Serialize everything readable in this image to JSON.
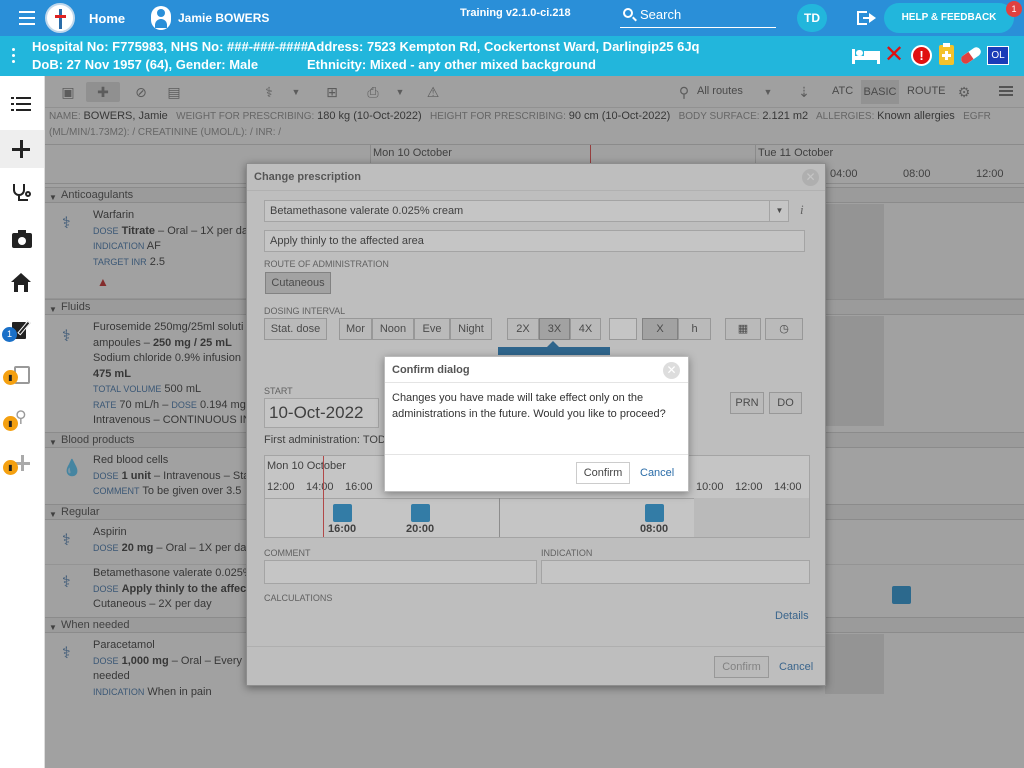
{
  "topbar": {
    "home_label": "Home",
    "patient_name": "Jamie BOWERS",
    "version": "Training v2.1.0-ci.218",
    "search_label": "Search",
    "user_initials": "TD",
    "help_label": "HELP & FEEDBACK",
    "help_badge": "1"
  },
  "patient_bar": {
    "line1_left": "Hospital No: F775983, NHS No: ###-###-####",
    "line1_right": "Address: 7523 Kempton Rd, Cockertonst Ward, Darlingip25 6Jq",
    "line2_left": "DoB: 27 Nov 1957 (64), Gender: Male",
    "line2_right": "Ethnicity: Mixed - any other mixed background",
    "ol_badge": "OL"
  },
  "leftnav": {
    "badge": "1"
  },
  "toolbar": {
    "routes_label": "All routes",
    "atc_label": "ATC",
    "basic_label": "BASIC",
    "route_label": "ROUTE"
  },
  "info": {
    "name_lbl": "NAME:",
    "name_val": "BOWERS, Jamie",
    "weight_lbl": "WEIGHT FOR PRESCRIBING:",
    "weight_val": "180 kg (10-Oct-2022)",
    "height_lbl": "HEIGHT FOR PRESCRIBING:",
    "height_val": "90 cm (10-Oct-2022)",
    "bsa_lbl": "BODY SURFACE:",
    "bsa_val": "2.121 m2",
    "allergy_lbl": "ALLERGIES:",
    "allergy_val": "Known allergies",
    "egfr_lbl": "EGFR",
    "line2": "(ML/MIN/1.73M2): /   CREATININE (UMOL/L): /   INR: /"
  },
  "timeline": {
    "day1": "Mon 10 October",
    "day2": "Tue 11 October",
    "t1": "04:00",
    "t2": "08:00",
    "t3": "12:00"
  },
  "sections": {
    "anticoag": "Anticoagulants",
    "fluids": "Fluids",
    "blood": "Blood products",
    "regular": "Regular",
    "when_needed": "When needed"
  },
  "drugs": {
    "warfarin": {
      "name": "Warfarin",
      "dose_lbl": "DOSE",
      "dose": "Titrate",
      "rest": " – Oral – 1X per da",
      "ind_lbl": "INDICATION",
      "ind": "AF",
      "inr_lbl": "TARGET INR",
      "inr": "2.5"
    },
    "furosemide": {
      "l1": "Furosemide 250mg/25ml soluti",
      "l2a": "ampoules – ",
      "l2b": "250 mg / 25 mL",
      "l3": "Sodium chloride 0.9% infusion",
      "l4": "475 mL",
      "vol_lbl": "TOTAL VOLUME",
      "vol": "500 mL",
      "rate_lbl": "RATE",
      "rate": "70 mL/h – ",
      "dose_lbl": "DOSE",
      "dose": "0.194 mg/l",
      "l7": "Intravenous – CONTINUOUS IN"
    },
    "rbc": {
      "name": "Red blood cells",
      "dose_lbl": "DOSE",
      "dose": "1 unit",
      "rest": " – Intravenous – Sta",
      "com_lbl": "COMMENT",
      "com": "To be given over 3.5"
    },
    "aspirin": {
      "name": "Aspirin",
      "dose_lbl": "DOSE",
      "dose": "20 mg",
      "rest": " – Oral – 1X per da"
    },
    "betamethasone": {
      "name": "Betamethasone valerate 0.025%",
      "dose_lbl": "DOSE",
      "dose": "Apply thinly to the affec",
      "route": "Cutaneous – 2X per day"
    },
    "paracetamol": {
      "name": "Paracetamol",
      "dose_lbl": "DOSE",
      "dose": "1,000 mg",
      "rest": " – Oral – Every",
      "l3": "needed",
      "ind_lbl": "INDICATION",
      "ind": "When in pain"
    }
  },
  "modal": {
    "title": "Change prescription",
    "drug_value": "Betamethasone valerate 0.025% cream",
    "dose_value": "Apply thinly to the affected area",
    "route_label": "ROUTE OF ADMINISTRATION",
    "route_btn": "Cutaneous",
    "dosing_label": "DOSING INTERVAL",
    "stat": "Stat. dose",
    "mor": "Mor",
    "noon": "Noon",
    "eve": "Eve",
    "night": "Night",
    "x2": "2X",
    "x3": "3X",
    "x4": "4X",
    "x": "X",
    "h": "h",
    "start_label": "START",
    "start_value": "10-Oct-2022",
    "prn": "PRN",
    "do": "DO",
    "first_admin": "First administration: TOD",
    "tl_day": "Mon 10 October",
    "tl_times": [
      "12:00",
      "14:00",
      "16:00",
      "10:00",
      "12:00",
      "14:00"
    ],
    "admin_times": [
      "16:00",
      "20:00",
      "08:00"
    ],
    "comment_label": "COMMENT",
    "indication_label": "INDICATION",
    "calc_label": "CALCULATIONS",
    "details": "Details",
    "confirm": "Confirm",
    "cancel": "Cancel"
  },
  "confirm_dialog": {
    "title": "Confirm dialog",
    "body": "Changes you have made will take effect only on the administrations in the future. Would you like to proceed?",
    "confirm": "Confirm",
    "cancel": "Cancel"
  },
  "colors": {
    "topbar": "#2a8fd8",
    "patient_bar": "#22b6dc",
    "admin_block": "#1f8fd0"
  }
}
